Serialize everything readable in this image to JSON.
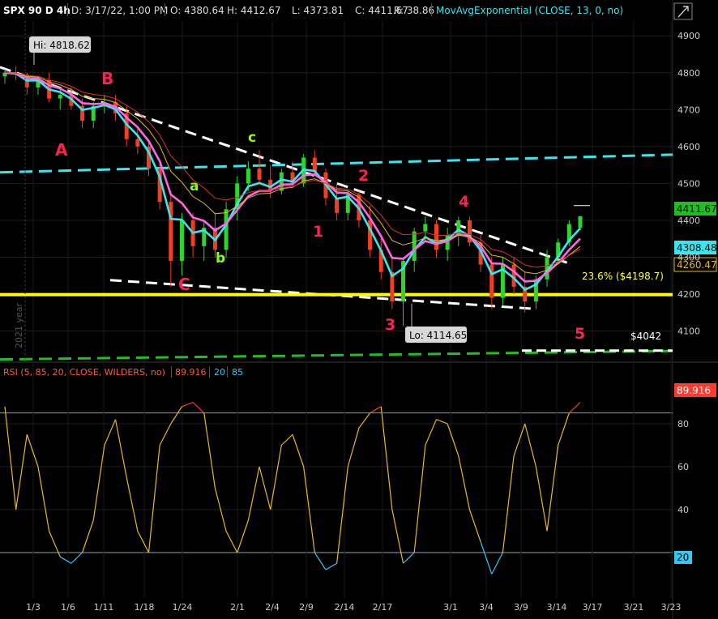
{
  "header": {
    "symbol": "SPX 90 D 4h",
    "date": "D: 3/17/22, 1:00 PM",
    "open": "O: 4380.64",
    "high": "H: 4412.67",
    "low": "L: 4373.81",
    "close": "C: 4411.67",
    "range": "R: 38.86",
    "study": "MovAvgExponential (CLOSE, 13, 0, no)"
  },
  "rsi_header": {
    "label": "RSI (5, 85, 20, CLOSE, WILDERS, no)",
    "value": "89.916",
    "lower": "20",
    "upper": "85"
  },
  "price_badges": {
    "last": "4411.67",
    "ema13": "4308.48",
    "ema_slow": "4260.47",
    "rsi_last": "89.916",
    "rsi_low": "20"
  },
  "annotations": {
    "hi": "Hi: 4818.62",
    "lo": "Lo: 4114.65",
    "fib": "23.6%  ($4198.7)",
    "target": "$4042",
    "year": "2021 year",
    "wave_labels": [
      "A",
      "B",
      "C",
      "a",
      "b",
      "c",
      "1",
      "2",
      "3",
      "4",
      "5"
    ]
  },
  "colors": {
    "background": "#000000",
    "up_candle": "#2bd72b",
    "down_candle": "#f04020",
    "ema13": "#35e8f0",
    "ema_mid": "#ff66e6",
    "ema_slow": "#e0302a",
    "ema_yellow": "#e3b81a",
    "support_line": "#ffff00",
    "rsi_line": "#e8b820",
    "rsi_over": "#ff3b2f",
    "rsi_under": "#35c8f0",
    "wave_red": "#ff2050",
    "wave_green": "#8cff00"
  },
  "chart_data": [
    {
      "type": "candlestick",
      "title": "SPX 90 D 4h",
      "x_tick_labels": [
        "1/3",
        "1/6",
        "1/11",
        "1/18",
        "1/24",
        "2/1",
        "2/4",
        "2/9",
        "2/14",
        "2/17",
        "3/1",
        "3/4",
        "3/9",
        "3/14",
        "3/17",
        "3/21",
        "3/23"
      ],
      "y_ticks": [
        4100,
        4200,
        4300,
        4400,
        4500,
        4600,
        4700,
        4800,
        4900
      ],
      "ylim": [
        4020,
        4940
      ],
      "candles_approx": [
        [
          4790,
          4810,
          4770,
          4800
        ],
        [
          4800,
          4818,
          4780,
          4795
        ],
        [
          4795,
          4800,
          4740,
          4760
        ],
        [
          4760,
          4790,
          4740,
          4780
        ],
        [
          4780,
          4800,
          4720,
          4730
        ],
        [
          4730,
          4760,
          4700,
          4740
        ],
        [
          4740,
          4760,
          4700,
          4710
        ],
        [
          4710,
          4730,
          4650,
          4670
        ],
        [
          4670,
          4720,
          4650,
          4710
        ],
        [
          4710,
          4740,
          4690,
          4720
        ],
        [
          4720,
          4740,
          4670,
          4690
        ],
        [
          4690,
          4710,
          4600,
          4620
        ],
        [
          4620,
          4650,
          4580,
          4600
        ],
        [
          4600,
          4620,
          4520,
          4540
        ],
        [
          4540,
          4560,
          4430,
          4450
        ],
        [
          4450,
          4480,
          4220,
          4290
        ],
        [
          4290,
          4420,
          4250,
          4400
        ],
        [
          4400,
          4420,
          4300,
          4330
        ],
        [
          4330,
          4400,
          4290,
          4380
        ],
        [
          4380,
          4420,
          4300,
          4320
        ],
        [
          4320,
          4450,
          4300,
          4430
        ],
        [
          4430,
          4520,
          4400,
          4500
        ],
        [
          4500,
          4560,
          4480,
          4540
        ],
        [
          4540,
          4590,
          4500,
          4510
        ],
        [
          4510,
          4550,
          4460,
          4480
        ],
        [
          4480,
          4540,
          4470,
          4530
        ],
        [
          4530,
          4560,
          4490,
          4500
        ],
        [
          4500,
          4580,
          4490,
          4570
        ],
        [
          4570,
          4590,
          4520,
          4530
        ],
        [
          4530,
          4540,
          4440,
          4460
        ],
        [
          4460,
          4500,
          4400,
          4420
        ],
        [
          4420,
          4480,
          4400,
          4470
        ],
        [
          4470,
          4480,
          4380,
          4400
        ],
        [
          4400,
          4440,
          4300,
          4320
        ],
        [
          4320,
          4360,
          4240,
          4260
        ],
        [
          4260,
          4300,
          4160,
          4180
        ],
        [
          4180,
          4300,
          4114,
          4290
        ],
        [
          4290,
          4380,
          4260,
          4370
        ],
        [
          4370,
          4410,
          4340,
          4390
        ],
        [
          4390,
          4400,
          4300,
          4320
        ],
        [
          4320,
          4380,
          4290,
          4360
        ],
        [
          4360,
          4410,
          4330,
          4400
        ],
        [
          4400,
          4410,
          4330,
          4340
        ],
        [
          4340,
          4360,
          4260,
          4280
        ],
        [
          4280,
          4300,
          4160,
          4190
        ],
        [
          4190,
          4300,
          4170,
          4280
        ],
        [
          4280,
          4300,
          4200,
          4220
        ],
        [
          4220,
          4260,
          4150,
          4180
        ],
        [
          4180,
          4250,
          4160,
          4240
        ],
        [
          4240,
          4320,
          4220,
          4300
        ],
        [
          4300,
          4350,
          4280,
          4340
        ],
        [
          4340,
          4400,
          4330,
          4390
        ],
        [
          4380,
          4412,
          4373,
          4411
        ]
      ]
    },
    {
      "type": "line",
      "title": "RSI (5, 85, 20, CLOSE, WILDERS, no)",
      "y_ticks": [
        20,
        40,
        60,
        80
      ],
      "ylim": [
        0,
        100
      ],
      "thresholds": [
        20,
        85
      ],
      "last_value": 89.916
    }
  ]
}
